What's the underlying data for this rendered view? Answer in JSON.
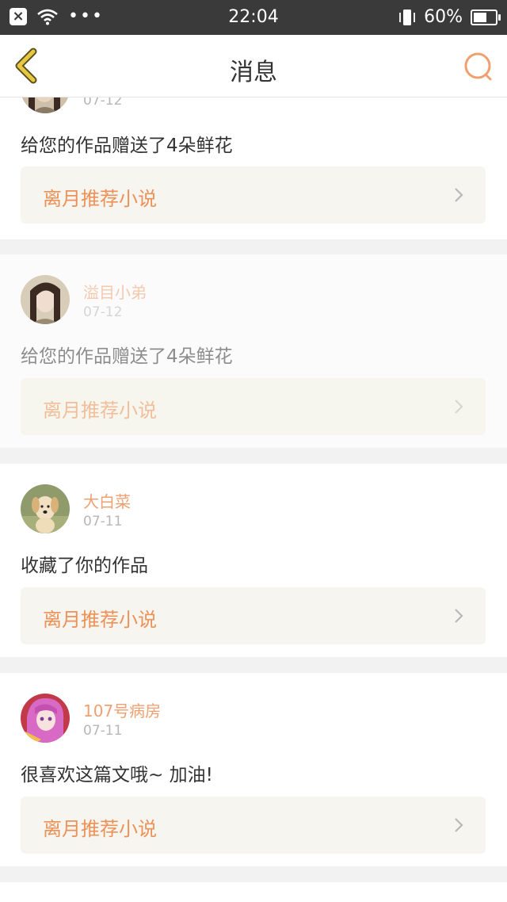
{
  "status_bar": {
    "time": "22:04",
    "battery": "60%",
    "battery_level": 0.6
  },
  "header": {
    "title": "消息"
  },
  "messages": [
    {
      "name": "",
      "date": "07-12",
      "text": "给您的作品赠送了4朵鲜花",
      "work": "离月推荐小说",
      "avatar": "swordsman-avatar"
    },
    {
      "name": "溢目小弟",
      "date": "07-12",
      "text": "给您的作品赠送了4朵鲜花",
      "work": "离月推荐小说",
      "avatar": "swordsman-avatar"
    },
    {
      "name": "大白菜",
      "date": "07-11",
      "text": "收藏了你的作品",
      "work": "离月推荐小说",
      "avatar": "puppy-avatar"
    },
    {
      "name": "107号病房",
      "date": "07-11",
      "text": "很喜欢这篇文哦~ 加油!",
      "work": "离月推荐小说",
      "avatar": "anime-girl-avatar"
    }
  ],
  "colors": {
    "accent": "#ec9258",
    "back_arrow": "#e8c840",
    "search_icon": "#f0a070"
  }
}
